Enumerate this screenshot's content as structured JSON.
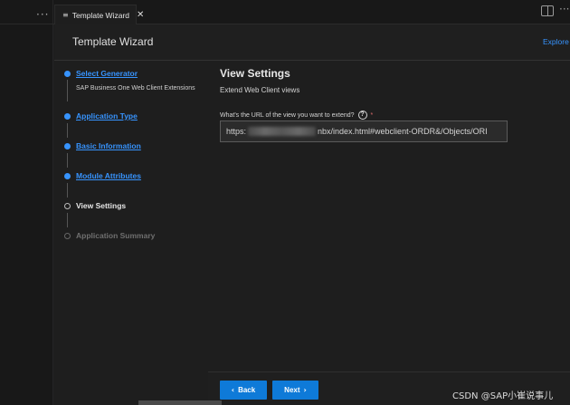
{
  "sidebar": {
    "more_glyph": "···"
  },
  "tab": {
    "icon": "≡",
    "label": "Template Wizard",
    "close_glyph": "✕"
  },
  "window": {
    "actions_glyph": "···"
  },
  "wizard": {
    "title": "Template Wizard",
    "explore_link": "Explore"
  },
  "steps": [
    {
      "label": "Select Generator",
      "state": "done",
      "sub": "SAP Business One Web Client Extensions"
    },
    {
      "label": "Application Type",
      "state": "done"
    },
    {
      "label": "Basic Information",
      "state": "done"
    },
    {
      "label": "Module Attributes",
      "state": "done"
    },
    {
      "label": "View Settings",
      "state": "current"
    },
    {
      "label": "Application Summary",
      "state": "pending"
    }
  ],
  "view": {
    "title": "View Settings",
    "subtitle": "Extend Web Client views",
    "question": "What's the URL of the view you want to extend?",
    "help_glyph": "?",
    "required_mark": "*",
    "url_prefix": "https:",
    "url_suffix": "nbx/index.html#webclient-ORDR&/Objects/ORI"
  },
  "footer": {
    "back_label": "Back",
    "next_label": "Next",
    "back_glyph": "‹",
    "next_glyph": "›"
  },
  "watermark": "CSDN @SAP小崔说事儿",
  "colors": {
    "accent": "#3794ff",
    "button": "#0e7ad8",
    "background": "#1e1e1e"
  },
  "icons": [
    "more-icon",
    "file-icon",
    "close-icon",
    "split-editor-icon",
    "help-icon",
    "chevron-left-icon",
    "chevron-right-icon"
  ]
}
